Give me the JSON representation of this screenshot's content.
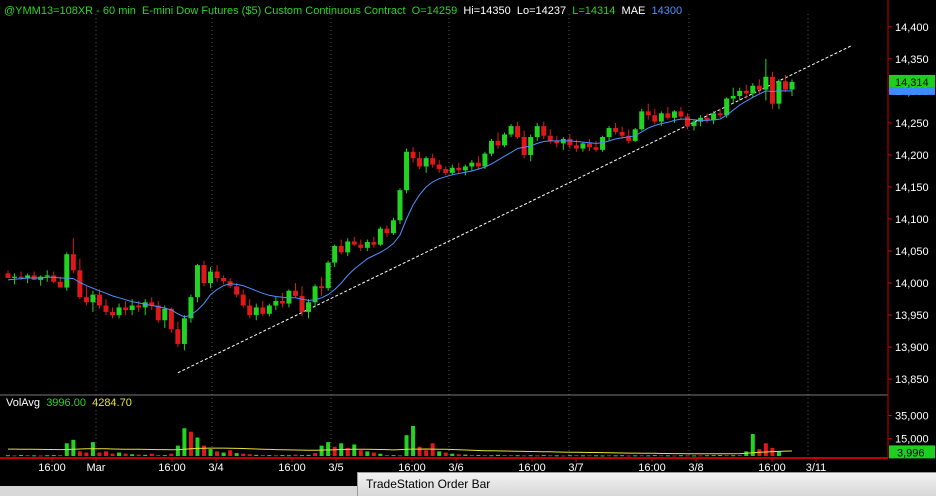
{
  "header": {
    "symbol": "@YMM13=108XR - 60 min",
    "description": "E-mini Dow Futures ($5) Custom Continuous Contract",
    "open": "O=14259",
    "high": "Hi=14350",
    "low": "Lo=14237",
    "last": "L=14314",
    "indicator_name": "MAE",
    "indicator_value": "14300"
  },
  "volume_header": {
    "name": "VolAvg",
    "value1": "3996.00",
    "value2": "4284.70"
  },
  "price_axis": {
    "labels": [
      "14,400",
      "14,350",
      "14,300",
      "14,250",
      "14,200",
      "14,150",
      "14,100",
      "14,050",
      "14,000",
      "13,950",
      "13,900",
      "13,850"
    ],
    "last_price_tag": "14,314",
    "indicator_tag": "14,300"
  },
  "volume_axis": {
    "labels": [
      "35,000",
      "15,000"
    ],
    "last_volume_tag": "3,996"
  },
  "time_axis": {
    "labels": [
      "16:00",
      "Mar",
      "16:00",
      "3/4",
      "16:00",
      "3/5",
      "16:00",
      "3/6",
      "16:00",
      "3/7",
      "16:00",
      "3/8",
      "16:00",
      "3/11"
    ]
  },
  "order_bar": {
    "title": "TradeStation Order Bar"
  },
  "colors": {
    "up": "#22d322",
    "down": "#e01818",
    "mae": "#4f8fff",
    "volavg": "#e5e337",
    "trendline": "#ffffff",
    "last_tag": "#1fcf1f",
    "mae_tag": "#3a8cff"
  },
  "chart_data": {
    "type": "candlestick",
    "ylim": [
      13830,
      14420
    ],
    "trendline": {
      "from": 13860,
      "to": 14370
    },
    "candles": [
      [
        14015,
        14020,
        14012,
        14008
      ],
      [
        14008,
        14015,
        13998,
        14010
      ],
      [
        14010,
        14018,
        14005,
        14008
      ],
      [
        14008,
        14015,
        14000,
        14012
      ],
      [
        14012,
        14018,
        14005,
        14005
      ],
      [
        14005,
        14012,
        13996,
        14010
      ],
      [
        14010,
        14020,
        14002,
        14012
      ],
      [
        14012,
        14018,
        14000,
        14002
      ],
      [
        14002,
        14010,
        13993,
        13993
      ],
      [
        13993,
        14048,
        13988,
        14045
      ],
      [
        14045,
        14070,
        14015,
        14020
      ],
      [
        14020,
        14038,
        13975,
        13978
      ],
      [
        13978,
        13995,
        13965,
        13970
      ],
      [
        13970,
        13988,
        13955,
        13982
      ],
      [
        13982,
        13990,
        13960,
        13965
      ],
      [
        13965,
        13975,
        13950,
        13955
      ],
      [
        13955,
        13962,
        13945,
        13950
      ],
      [
        13950,
        13968,
        13945,
        13962
      ],
      [
        13962,
        13972,
        13950,
        13958
      ],
      [
        13958,
        13975,
        13950,
        13965
      ],
      [
        13965,
        13972,
        13955,
        13962
      ],
      [
        13962,
        13975,
        13950,
        13970
      ],
      [
        13970,
        13978,
        13958,
        13965
      ],
      [
        13965,
        13972,
        13938,
        13942
      ],
      [
        13942,
        13965,
        13930,
        13960
      ],
      [
        13960,
        13962,
        13922,
        13928
      ],
      [
        13928,
        13940,
        13900,
        13905
      ],
      [
        13905,
        13950,
        13895,
        13945
      ],
      [
        13945,
        13982,
        13938,
        13978
      ],
      [
        13978,
        14030,
        13970,
        14028
      ],
      [
        14028,
        14035,
        13995,
        14000
      ],
      [
        14000,
        14025,
        13992,
        14018
      ],
      [
        14018,
        14028,
        14002,
        14008
      ],
      [
        14008,
        14012,
        13998,
        14003
      ],
      [
        14003,
        14008,
        13992,
        13995
      ],
      [
        13995,
        14000,
        13978,
        13982
      ],
      [
        13982,
        13990,
        13962,
        13965
      ],
      [
        13965,
        13975,
        13945,
        13950
      ],
      [
        13950,
        13968,
        13942,
        13962
      ],
      [
        13962,
        13972,
        13948,
        13952
      ],
      [
        13952,
        13968,
        13948,
        13965
      ],
      [
        13965,
        13978,
        13958,
        13972
      ],
      [
        13972,
        13985,
        13962,
        13968
      ],
      [
        13968,
        13990,
        13962,
        13988
      ],
      [
        13988,
        14000,
        13978,
        13980
      ],
      [
        13980,
        13995,
        13948,
        13955
      ],
      [
        13955,
        13975,
        13945,
        13970
      ],
      [
        13970,
        13998,
        13962,
        13995
      ],
      [
        13995,
        14010,
        13980,
        13992
      ],
      [
        13992,
        14035,
        13988,
        14032
      ],
      [
        14032,
        14060,
        14025,
        14058
      ],
      [
        14058,
        14068,
        14045,
        14048
      ],
      [
        14048,
        14070,
        14042,
        14065
      ],
      [
        14065,
        14072,
        14058,
        14060
      ],
      [
        14060,
        14068,
        14050,
        14055
      ],
      [
        14055,
        14068,
        14050,
        14064
      ],
      [
        14064,
        14072,
        14055,
        14060
      ],
      [
        14060,
        14088,
        14058,
        14085
      ],
      [
        14085,
        14090,
        14072,
        14078
      ],
      [
        14078,
        14102,
        14075,
        14098
      ],
      [
        14098,
        14148,
        14092,
        14145
      ],
      [
        14145,
        14210,
        14140,
        14205
      ],
      [
        14205,
        14212,
        14188,
        14195
      ],
      [
        14195,
        14205,
        14178,
        14182
      ],
      [
        14182,
        14198,
        14172,
        14195
      ],
      [
        14195,
        14202,
        14180,
        14185
      ],
      [
        14185,
        14192,
        14172,
        14178
      ],
      [
        14178,
        14182,
        14168,
        14172
      ],
      [
        14172,
        14185,
        14168,
        14180
      ],
      [
        14180,
        14188,
        14172,
        14176
      ],
      [
        14176,
        14185,
        14168,
        14182
      ],
      [
        14182,
        14192,
        14175,
        14188
      ],
      [
        14188,
        14198,
        14178,
        14182
      ],
      [
        14182,
        14205,
        14178,
        14202
      ],
      [
        14202,
        14225,
        14198,
        14222
      ],
      [
        14222,
        14235,
        14210,
        14215
      ],
      [
        14215,
        14235,
        14212,
        14232
      ],
      [
        14232,
        14248,
        14228,
        14245
      ],
      [
        14245,
        14252,
        14225,
        14228
      ],
      [
        14228,
        14238,
        14195,
        14200
      ],
      [
        14200,
        14232,
        14190,
        14228
      ],
      [
        14228,
        14250,
        14222,
        14245
      ],
      [
        14245,
        14252,
        14225,
        14230
      ],
      [
        14230,
        14240,
        14218,
        14222
      ],
      [
        14222,
        14230,
        14212,
        14218
      ],
      [
        14218,
        14228,
        14208,
        14225
      ],
      [
        14225,
        14232,
        14210,
        14215
      ],
      [
        14215,
        14224,
        14205,
        14210
      ],
      [
        14210,
        14220,
        14205,
        14218
      ],
      [
        14218,
        14225,
        14206,
        14212
      ],
      [
        14212,
        14222,
        14205,
        14208
      ],
      [
        14208,
        14230,
        14205,
        14228
      ],
      [
        14228,
        14245,
        14222,
        14242
      ],
      [
        14242,
        14250,
        14232,
        14236
      ],
      [
        14236,
        14244,
        14225,
        14230
      ],
      [
        14230,
        14240,
        14218,
        14222
      ],
      [
        14222,
        14242,
        14220,
        14240
      ],
      [
        14240,
        14272,
        14238,
        14268
      ],
      [
        14268,
        14280,
        14255,
        14262
      ],
      [
        14262,
        14272,
        14248,
        14252
      ],
      [
        14252,
        14268,
        14245,
        14265
      ],
      [
        14265,
        14275,
        14255,
        14258
      ],
      [
        14258,
        14270,
        14250,
        14268
      ],
      [
        14268,
        14275,
        14255,
        14260
      ],
      [
        14260,
        14265,
        14240,
        14245
      ],
      [
        14245,
        14255,
        14238,
        14252
      ],
      [
        14252,
        14262,
        14245,
        14258
      ],
      [
        14258,
        14265,
        14250,
        14254
      ],
      [
        14254,
        14268,
        14248,
        14265
      ],
      [
        14265,
        14272,
        14258,
        14262
      ],
      [
        14262,
        14290,
        14258,
        14288
      ],
      [
        14288,
        14305,
        14280,
        14292
      ],
      [
        14292,
        14305,
        14285,
        14300
      ],
      [
        14300,
        14310,
        14288,
        14296
      ],
      [
        14296,
        14312,
        14290,
        14308
      ],
      [
        14308,
        14318,
        14295,
        14302
      ],
      [
        14302,
        14350,
        14285,
        14322
      ],
      [
        14322,
        14330,
        14272,
        14280
      ],
      [
        14280,
        14318,
        14272,
        14315
      ],
      [
        14315,
        14325,
        14298,
        14302
      ],
      [
        14302,
        14318,
        14292,
        14314
      ]
    ],
    "mae": [
      14005,
      14006,
      14007,
      14008,
      14008,
      14008,
      14009,
      14009,
      14008,
      14008,
      14007,
      14001,
      13996,
      13992,
      13988,
      13984,
      13980,
      13977,
      13974,
      13971,
      13969,
      13967,
      13965,
      13963,
      13961,
      13958,
      13952,
      13947,
      13950,
      13958,
      13968,
      13982,
      13990,
      13996,
      13999,
      13998,
      13996,
      13992,
      13988,
      13984,
      13981,
      13979,
      13978,
      13977,
      13977,
      13975,
      13973,
      13974,
      13977,
      13982,
      13990,
      14000,
      14012,
      14022,
      14030,
      14038,
      14043,
      14048,
      14054,
      14062,
      14075,
      14100,
      14122,
      14138,
      14150,
      14158,
      14163,
      14166,
      14169,
      14171,
      14173,
      14175,
      14178,
      14181,
      14186,
      14192,
      14198,
      14204,
      14210,
      14212,
      14214,
      14218,
      14221,
      14222,
      14222,
      14222,
      14222,
      14221,
      14220,
      14219,
      14218,
      14219,
      14222,
      14225,
      14227,
      14228,
      14230,
      14236,
      14242,
      14246,
      14249,
      14251,
      14254,
      14256,
      14256,
      14255,
      14254,
      14254,
      14255,
      14256,
      14262,
      14270,
      14278,
      14284,
      14290,
      14295,
      14300,
      14299,
      14300,
      14300,
      14300
    ],
    "volume": [
      [
        700,
        "up"
      ],
      [
        600,
        "down"
      ],
      [
        900,
        "up"
      ],
      [
        800,
        "down"
      ],
      [
        600,
        "up"
      ],
      [
        500,
        "down"
      ],
      [
        700,
        "up"
      ],
      [
        800,
        "up"
      ],
      [
        900,
        "down"
      ],
      [
        11000,
        "up"
      ],
      [
        14000,
        "up"
      ],
      [
        4000,
        "down"
      ],
      [
        3000,
        "down"
      ],
      [
        12000,
        "up"
      ],
      [
        3000,
        "down"
      ],
      [
        4000,
        "down"
      ],
      [
        2000,
        "down"
      ],
      [
        3000,
        "up"
      ],
      [
        2000,
        "down"
      ],
      [
        1500,
        "up"
      ],
      [
        1200,
        "down"
      ],
      [
        1000,
        "up"
      ],
      [
        2000,
        "down"
      ],
      [
        900,
        "down"
      ],
      [
        800,
        "up"
      ],
      [
        2000,
        "down"
      ],
      [
        9000,
        "up"
      ],
      [
        24000,
        "up"
      ],
      [
        21000,
        "down"
      ],
      [
        16000,
        "up"
      ],
      [
        9000,
        "down"
      ],
      [
        6000,
        "up"
      ],
      [
        4000,
        "down"
      ],
      [
        3000,
        "up"
      ],
      [
        5000,
        "down"
      ],
      [
        2500,
        "up"
      ],
      [
        2000,
        "down"
      ],
      [
        1500,
        "down"
      ],
      [
        1000,
        "up"
      ],
      [
        900,
        "down"
      ],
      [
        800,
        "up"
      ],
      [
        700,
        "down"
      ],
      [
        900,
        "up"
      ],
      [
        700,
        "up"
      ],
      [
        1200,
        "down"
      ],
      [
        800,
        "up"
      ],
      [
        1000,
        "up"
      ],
      [
        2500,
        "down"
      ],
      [
        9000,
        "up"
      ],
      [
        12000,
        "up"
      ],
      [
        8000,
        "down"
      ],
      [
        11000,
        "up"
      ],
      [
        7000,
        "down"
      ],
      [
        10000,
        "up"
      ],
      [
        5000,
        "down"
      ],
      [
        4000,
        "up"
      ],
      [
        3000,
        "down"
      ],
      [
        2000,
        "up"
      ],
      [
        900,
        "down"
      ],
      [
        800,
        "up"
      ],
      [
        700,
        "down"
      ],
      [
        18000,
        "up"
      ],
      [
        26000,
        "up"
      ],
      [
        8000,
        "down"
      ],
      [
        5000,
        "down"
      ],
      [
        11000,
        "down"
      ],
      [
        4000,
        "up"
      ],
      [
        3000,
        "down"
      ],
      [
        2000,
        "up"
      ],
      [
        1500,
        "down"
      ],
      [
        1200,
        "up"
      ],
      [
        1000,
        "down"
      ],
      [
        900,
        "up"
      ],
      [
        800,
        "down"
      ],
      [
        700,
        "up"
      ],
      [
        1000,
        "up"
      ],
      [
        900,
        "down"
      ],
      [
        800,
        "down"
      ],
      [
        700,
        "up"
      ],
      [
        600,
        "down"
      ],
      [
        700,
        "up"
      ],
      [
        600,
        "down"
      ],
      [
        800,
        "up"
      ],
      [
        700,
        "down"
      ],
      [
        600,
        "up"
      ],
      [
        500,
        "down"
      ],
      [
        700,
        "up"
      ],
      [
        800,
        "down"
      ],
      [
        600,
        "up"
      ],
      [
        700,
        "down"
      ],
      [
        600,
        "up"
      ],
      [
        500,
        "up"
      ],
      [
        700,
        "down"
      ],
      [
        600,
        "up"
      ],
      [
        700,
        "up"
      ],
      [
        500,
        "down"
      ],
      [
        600,
        "up"
      ],
      [
        700,
        "down"
      ],
      [
        600,
        "up"
      ],
      [
        800,
        "up"
      ],
      [
        700,
        "down"
      ],
      [
        600,
        "up"
      ],
      [
        500,
        "down"
      ],
      [
        700,
        "up"
      ],
      [
        600,
        "down"
      ],
      [
        500,
        "up"
      ],
      [
        600,
        "down"
      ],
      [
        700,
        "up"
      ],
      [
        800,
        "up"
      ],
      [
        900,
        "up"
      ],
      [
        800,
        "down"
      ],
      [
        700,
        "up"
      ],
      [
        900,
        "down"
      ],
      [
        4000,
        "up"
      ],
      [
        19000,
        "up"
      ],
      [
        6000,
        "down"
      ],
      [
        11000,
        "down"
      ],
      [
        7000,
        "down"
      ],
      [
        4000,
        "up"
      ]
    ],
    "volavg": [
      6000,
      6000,
      5900,
      5900,
      5800,
      5700,
      5600,
      5600,
      5500,
      5600,
      5900,
      6100,
      6200,
      6300,
      6300,
      6200,
      6100,
      6000,
      5900,
      5900,
      5800,
      5700,
      5600,
      5500,
      5500,
      5400,
      5500,
      5900,
      6300,
      6600,
      6700,
      6800,
      6800,
      6800,
      6700,
      6600,
      6500,
      6300,
      6100,
      5900,
      5700,
      5500,
      5400,
      5300,
      5200,
      5100,
      5000,
      5000,
      5100,
      5300,
      5400,
      5600,
      5700,
      5800,
      5800,
      5800,
      5700,
      5600,
      5500,
      5300,
      5500,
      5900,
      6000,
      6000,
      6100,
      6000,
      5900,
      5800,
      5600,
      5400,
      5200,
      5000,
      4800,
      4600,
      4500,
      4400,
      4300,
      4200,
      4100,
      4000,
      3900,
      3800,
      3700,
      3600,
      3500,
      3400,
      3300,
      3200,
      3100,
      3000,
      3000,
      2900,
      2800,
      2700,
      2600,
      2500,
      2500,
      2400,
      2300,
      2300,
      2200,
      2200,
      2100,
      2100,
      2000,
      2000,
      2000,
      2000,
      2000,
      2000,
      2000,
      2000,
      2100,
      2400,
      2800,
      3200,
      3500,
      3800,
      4000,
      4200,
      4285
    ]
  }
}
